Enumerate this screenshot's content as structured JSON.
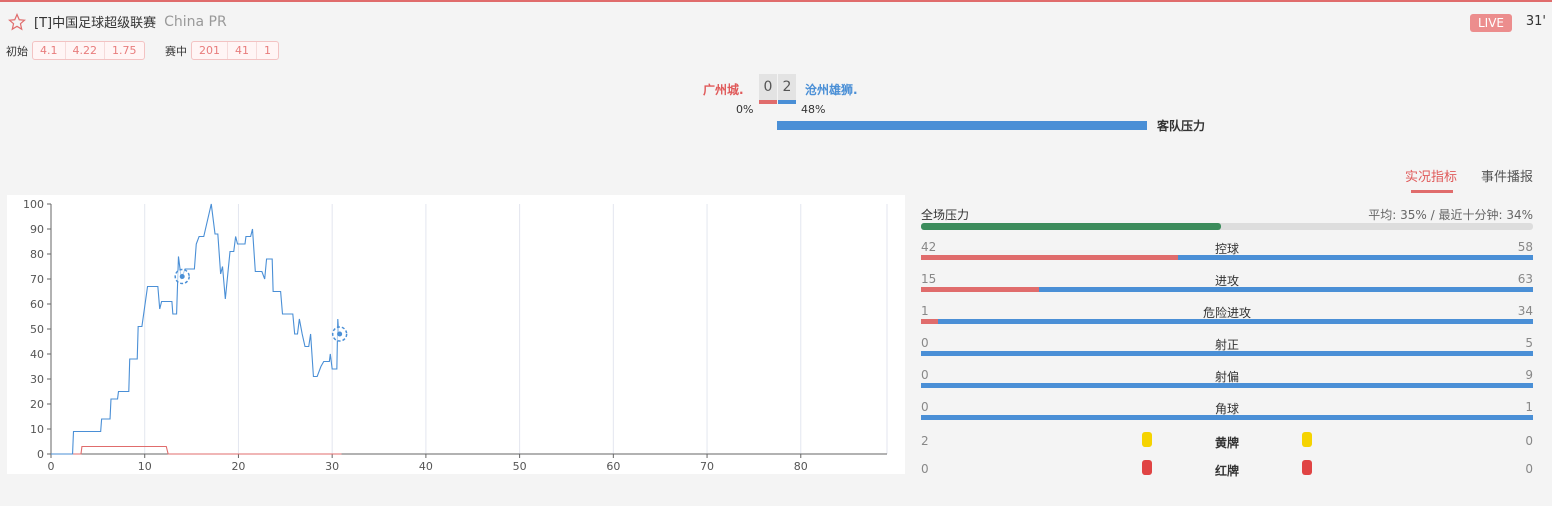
{
  "header": {
    "star_icon": "star-outline",
    "league": "[T]中国足球超级联赛",
    "country": "China PR",
    "live": "LIVE",
    "minute": "31'"
  },
  "odds": {
    "initial_label": "初始",
    "initial": [
      "4.1",
      "4.22",
      "1.75"
    ],
    "live_label": "赛中",
    "live": [
      "201",
      "41",
      "1"
    ]
  },
  "match": {
    "home": "广州城.",
    "away": "沧州雄狮.",
    "home_score": "0",
    "away_score": "2",
    "home_pct": "0%",
    "away_pct": "48%",
    "pressure_label": "客队压力",
    "pressure_away_fraction": 0.48
  },
  "tabs": [
    {
      "label": "实况指标",
      "active": true
    },
    {
      "label": "事件播报",
      "active": false
    }
  ],
  "pressure": {
    "label": "全场压力",
    "summary": "平均: 35% / 最近十分钟: 34%",
    "fraction": 0.49
  },
  "stats": [
    {
      "label": "控球",
      "home": "42",
      "away": "58"
    },
    {
      "label": "进攻",
      "home": "15",
      "away": "63"
    },
    {
      "label": "危险进攻",
      "home": "1",
      "away": "34"
    },
    {
      "label": "射正",
      "home": "0",
      "away": "5"
    },
    {
      "label": "射偏",
      "home": "0",
      "away": "9"
    },
    {
      "label": "角球",
      "home": "0",
      "away": "1"
    }
  ],
  "cards": [
    {
      "label": "黄牌",
      "home": "2",
      "away": "0",
      "color": "#f5d300"
    },
    {
      "label": "红牌",
      "home": "0",
      "away": "0",
      "color": "#e04444"
    }
  ],
  "colors": {
    "home": "#e06c6c",
    "away": "#4a8fd6",
    "pressure": "#3c8c5c"
  },
  "chart_data": {
    "type": "line",
    "xlim": [
      0,
      90
    ],
    "ylim": [
      0,
      100
    ],
    "xticks": [
      "0",
      "10",
      "20",
      "30",
      "40",
      "50",
      "60",
      "70",
      "80"
    ],
    "yticks": [
      "0",
      "10",
      "20",
      "30",
      "40",
      "50",
      "60",
      "70",
      "80",
      "90",
      "100"
    ],
    "series": [
      {
        "name": "away",
        "color": "#4a8fd6",
        "points": [
          [
            0,
            0
          ],
          [
            2.3,
            0
          ],
          [
            2.4,
            9
          ],
          [
            5.3,
            9
          ],
          [
            5.4,
            14
          ],
          [
            6.3,
            14
          ],
          [
            6.4,
            22
          ],
          [
            7.1,
            22
          ],
          [
            7.2,
            25
          ],
          [
            8.3,
            25
          ],
          [
            8.4,
            38
          ],
          [
            9.2,
            38
          ],
          [
            9.3,
            51
          ],
          [
            9.7,
            51
          ],
          [
            10.3,
            67
          ],
          [
            11.4,
            67
          ],
          [
            11.6,
            58
          ],
          [
            11.8,
            61
          ],
          [
            12.9,
            61
          ],
          [
            13,
            56
          ],
          [
            13.4,
            56
          ],
          [
            13.6,
            79
          ],
          [
            13.9,
            70
          ],
          [
            14.3,
            74
          ],
          [
            15.3,
            74
          ],
          [
            15.5,
            84
          ],
          [
            15.8,
            87
          ],
          [
            16.3,
            87
          ],
          [
            17.1,
            100
          ],
          [
            17.5,
            88
          ],
          [
            17.8,
            88
          ],
          [
            18.1,
            72
          ],
          [
            18.3,
            75
          ],
          [
            18.6,
            62
          ],
          [
            19.1,
            81
          ],
          [
            19.5,
            81
          ],
          [
            19.7,
            87
          ],
          [
            19.9,
            84
          ],
          [
            20.7,
            84
          ],
          [
            20.8,
            87
          ],
          [
            21.3,
            87
          ],
          [
            21.5,
            90
          ],
          [
            21.8,
            73
          ],
          [
            22.5,
            73
          ],
          [
            22.8,
            70
          ],
          [
            23,
            78
          ],
          [
            23.6,
            78
          ],
          [
            23.7,
            65
          ],
          [
            24.5,
            65
          ],
          [
            24.7,
            56
          ],
          [
            25.8,
            56
          ],
          [
            26,
            48
          ],
          [
            26.3,
            48
          ],
          [
            26.5,
            54
          ],
          [
            26.8,
            48
          ],
          [
            27.1,
            43
          ],
          [
            27.5,
            43
          ],
          [
            27.7,
            48
          ],
          [
            28,
            31
          ],
          [
            28.4,
            31
          ],
          [
            28.8,
            35
          ],
          [
            29.1,
            37
          ],
          [
            29.7,
            37
          ],
          [
            29.8,
            40
          ],
          [
            30,
            34
          ],
          [
            30.5,
            34
          ],
          [
            30.6,
            54
          ],
          [
            30.7,
            48
          ]
        ]
      },
      {
        "name": "home",
        "color": "#e06c6c",
        "points": [
          [
            0,
            0
          ],
          [
            3.2,
            0
          ],
          [
            3.3,
            3
          ],
          [
            12.3,
            3
          ],
          [
            12.5,
            0
          ],
          [
            31,
            0
          ]
        ]
      }
    ],
    "goals": [
      {
        "minute": 14,
        "value": 71,
        "team": "away"
      },
      {
        "minute": 30.8,
        "value": 48,
        "team": "away"
      }
    ]
  }
}
